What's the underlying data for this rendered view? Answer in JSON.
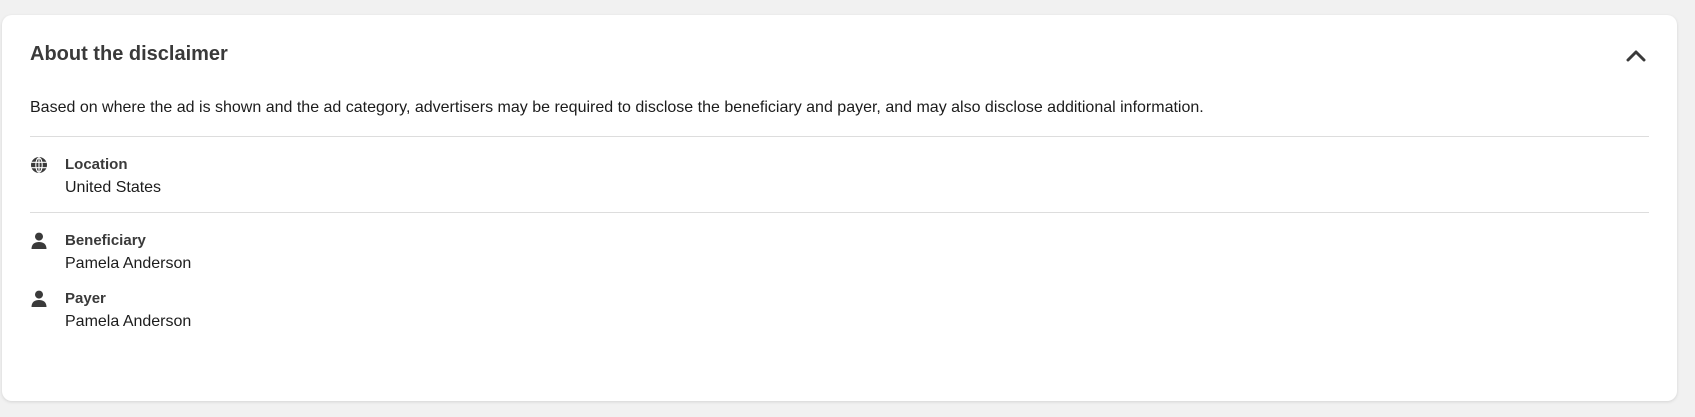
{
  "panel": {
    "title": "About the disclaimer",
    "description": "Based on where the ad is shown and the ad category, advertisers may be required to disclose the beneficiary and payer, and may also disclose additional information.",
    "collapse_icon": "chevron-up-icon"
  },
  "location": {
    "icon": "globe-icon",
    "label": "Location",
    "value": "United States"
  },
  "beneficiary": {
    "icon": "person-icon",
    "label": "Beneficiary",
    "value": "Pamela Anderson"
  },
  "payer": {
    "icon": "person-icon",
    "label": "Payer",
    "value": "Pamela Anderson"
  },
  "colors": {
    "page_background": "#f1f1f1",
    "card_background": "#ffffff",
    "divider": "#dddddd",
    "icon": "#3a3a3a"
  }
}
